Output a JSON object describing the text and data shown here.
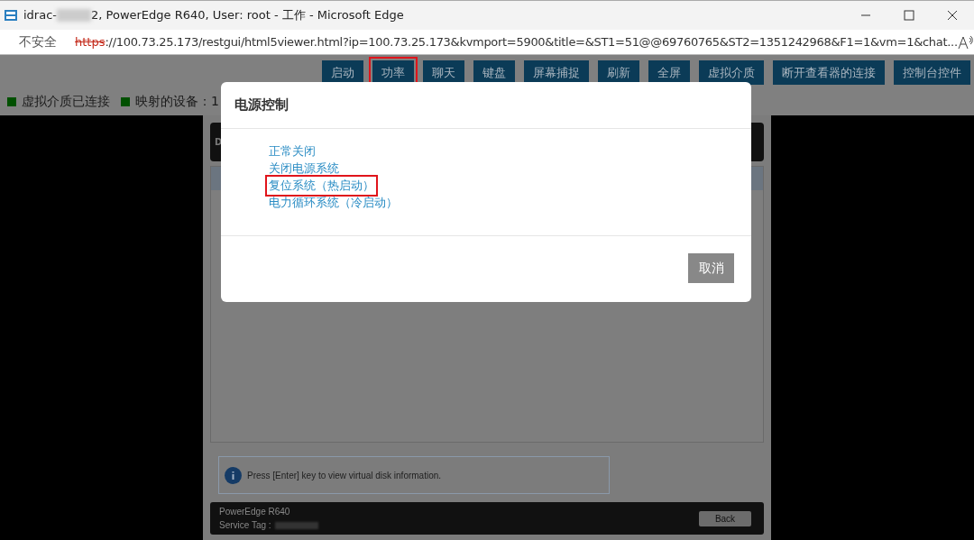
{
  "window": {
    "title_start": "idrac-",
    "title_end": "2, PowerEdge R640, User: root - 工作 - Microsoft Edge"
  },
  "address_bar": {
    "security": "不安全",
    "scheme": "https",
    "url": "://100.73.25.173/restgui/html5viewer.html?ip=100.73.25.173&kvmport=5900&title=&ST1=51@@69760765&ST2=1351242968&F1=1&vm=1&chat..."
  },
  "toolbar": [
    {
      "label": "启动",
      "highlighted": false
    },
    {
      "label": "功率",
      "highlighted": true
    },
    {
      "label": "聊天",
      "highlighted": false
    },
    {
      "label": "键盘",
      "highlighted": false
    },
    {
      "label": "屏幕捕捉",
      "highlighted": false
    },
    {
      "label": "刷新",
      "highlighted": false
    },
    {
      "label": "全屏",
      "highlighted": false
    },
    {
      "label": "虚拟介质",
      "highlighted": false
    },
    {
      "label": "断开查看器的连接",
      "highlighted": false
    },
    {
      "label": "控制台控件",
      "highlighted": false
    }
  ],
  "status": [
    {
      "label": "虚拟介质已连接",
      "color": "#005000"
    },
    {
      "label": "映射的设备：1",
      "color": "#005000"
    }
  ],
  "console": {
    "header_text": "D",
    "info": "Press [Enter] key to view virtual disk information.",
    "model": "PowerEdge R640",
    "service_tag_label": "Service Tag :",
    "back": "Back"
  },
  "dialog": {
    "title": "电源控制",
    "options": [
      {
        "label": "正常关闭",
        "highlighted": false
      },
      {
        "label": "关闭电源系统",
        "highlighted": false
      },
      {
        "label": "复位系统（热启动）",
        "highlighted": true
      },
      {
        "label": "电力循环系统（冷启动）",
        "highlighted": false
      }
    ],
    "cancel": "取消"
  }
}
